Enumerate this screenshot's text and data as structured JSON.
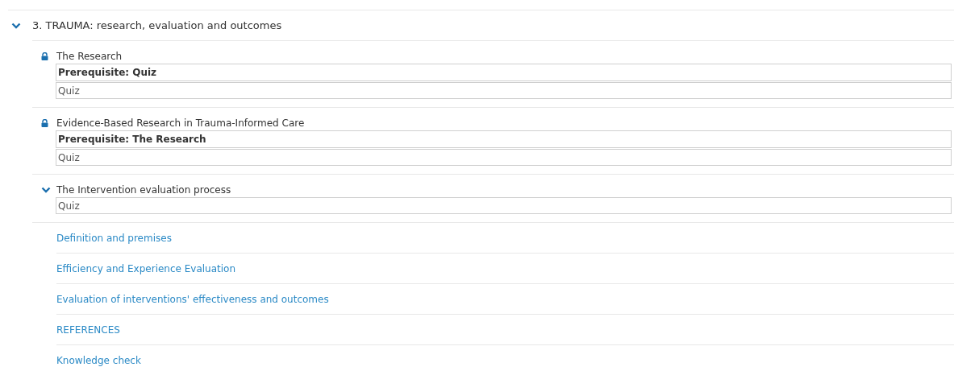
{
  "section": {
    "title": "3. TRAUMA: research, evaluation and outcomes",
    "expanded": true,
    "items": [
      {
        "kind": "locked",
        "title": "The Research",
        "prerequisite": "Prerequisite: Quiz",
        "activities": [
          "Quiz"
        ]
      },
      {
        "kind": "locked",
        "title": "Evidence-Based Research in Trauma-Informed Care",
        "prerequisite": "Prerequisite: The Research",
        "activities": [
          "Quiz"
        ]
      },
      {
        "kind": "expandable",
        "title": "The Intervention evaluation process",
        "expanded": true,
        "activities": [
          "Quiz"
        ],
        "children": [
          {
            "title": "Definition and premises"
          },
          {
            "title": "Efficiency and Experience Evaluation"
          },
          {
            "title": "Evaluation of interventions' effectiveness and outcomes"
          },
          {
            "title": "REFERENCES"
          },
          {
            "title": "Knowledge check"
          }
        ]
      }
    ]
  }
}
